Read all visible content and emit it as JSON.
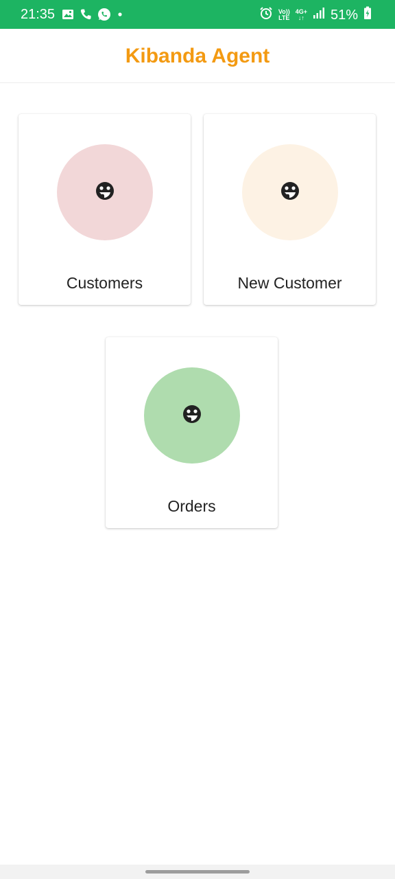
{
  "status_bar": {
    "time": "21:35",
    "battery": "51%",
    "volte_top": "Vo))",
    "volte_bottom": "LTE",
    "network_top": "4G+",
    "network_bottom": "↓↑",
    "icons": [
      "image-icon",
      "phone-icon",
      "whatsapp-icon",
      "dot-icon",
      "alarm-icon",
      "volte-icon",
      "network-4g-icon",
      "signal-icon",
      "battery-icon"
    ]
  },
  "app_bar": {
    "title": "Kibanda Agent",
    "title_color": "#f39a12"
  },
  "menu": {
    "items": [
      {
        "label": "Customers",
        "circle_color": "#f2d7d8",
        "icon": "face-icon"
      },
      {
        "label": "New Customer",
        "circle_color": "#fdf2e4",
        "icon": "face-icon"
      },
      {
        "label": "Orders",
        "circle_color": "#afdcae",
        "icon": "face-icon"
      }
    ]
  },
  "colors": {
    "status_bar": "#1db462",
    "background": "#ffffff"
  }
}
